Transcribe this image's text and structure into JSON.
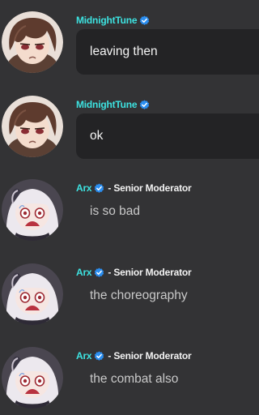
{
  "messages": [
    {
      "username": "MidnightTune",
      "role": "",
      "text": "leaving then",
      "avatar": "brown-hair-girl-avatar",
      "style": "bubble"
    },
    {
      "username": "MidnightTune",
      "role": "",
      "text": "ok",
      "avatar": "brown-hair-girl-avatar",
      "style": "bubble"
    },
    {
      "username": "Arx",
      "role": "- Senior Moderator",
      "text": "is so bad",
      "avatar": "white-hair-crying-girl-avatar",
      "style": "plain"
    },
    {
      "username": "Arx",
      "role": "- Senior Moderator",
      "text": "the choreography",
      "avatar": "white-hair-crying-girl-avatar",
      "style": "plain"
    },
    {
      "username": "Arx",
      "role": "- Senior Moderator",
      "text": "the combat also",
      "avatar": "white-hair-crying-girl-avatar",
      "style": "plain"
    }
  ],
  "colors": {
    "background": "#333335",
    "bubble": "#232325",
    "username": "#3de2e0",
    "verified_badge": "#2b8ef0",
    "role_text": "#f2f2f2",
    "message_text": "#c9c9c9"
  },
  "icons": {
    "verified": "verified-badge-icon"
  }
}
